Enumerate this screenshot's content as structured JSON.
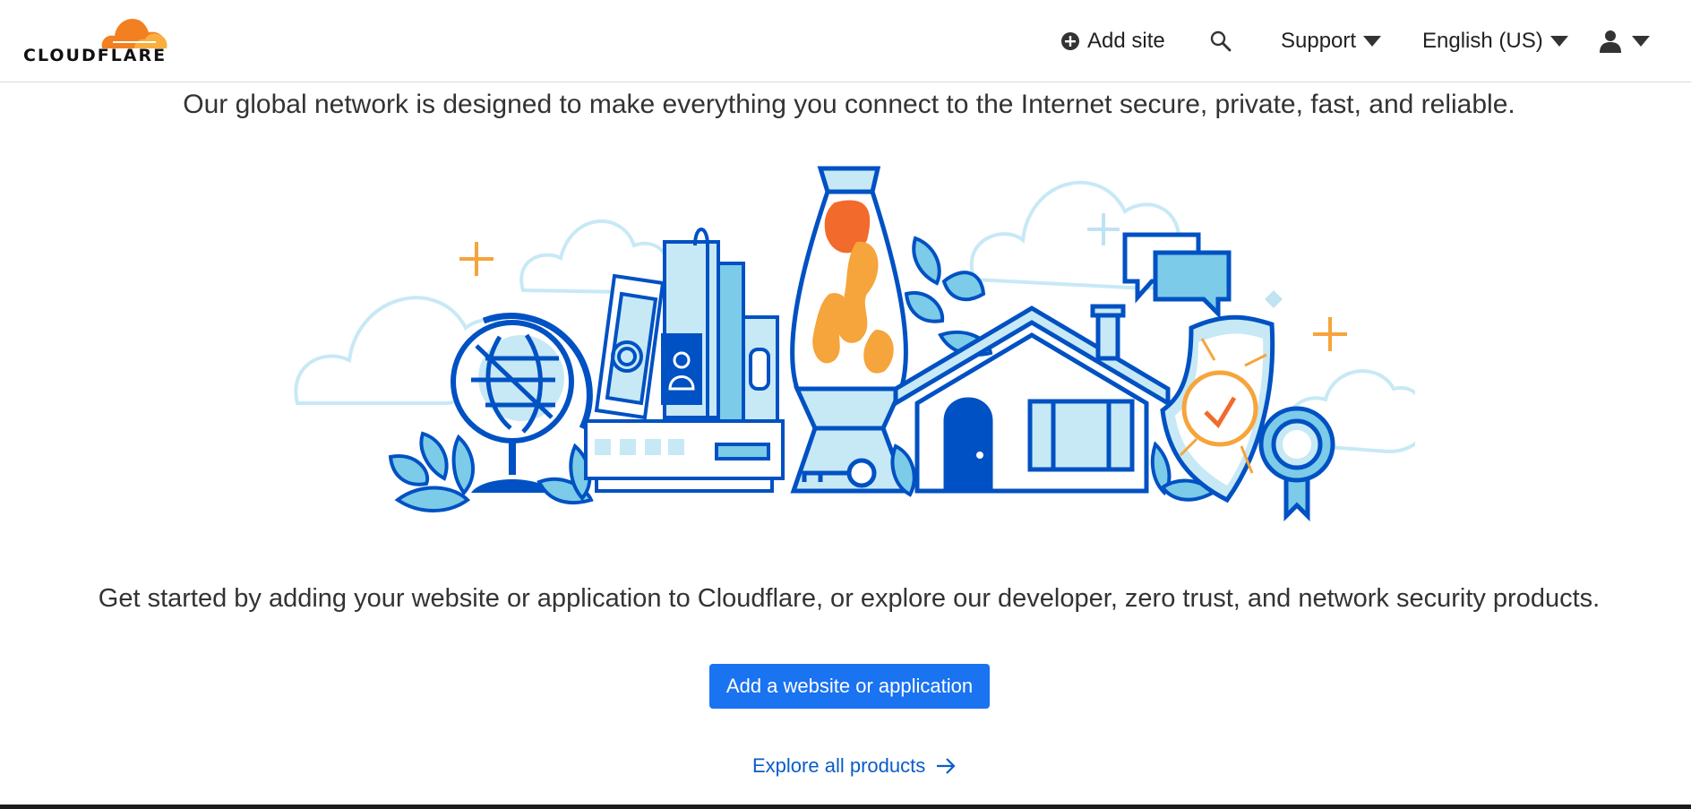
{
  "header": {
    "logo_text": "CLOUDFLARE",
    "add_site_label": "Add site",
    "support_label": "Support",
    "language_label": "English (US)"
  },
  "icons": {
    "logo": "cloudflare-cloud-icon",
    "add_site": "plus-circle-icon",
    "search": "search-icon",
    "user": "user-icon",
    "caret": "caret-down-icon",
    "explore": "arrow-right-icon"
  },
  "main": {
    "tagline": "Our global network is designed to make everything you connect to the Internet secure, private, fast, and reliable.",
    "intro": "Get started by adding your website or application to Cloudflare, or explore our developer, zero trust, and network security products.",
    "cta_label": "Add a website or application",
    "explore_label": "Explore all products"
  },
  "colors": {
    "brand_orange": "#f38020",
    "primary_blue": "#1a73f0",
    "link_blue": "#0b5cc9",
    "illustration_blue": "#0051c3",
    "illustration_light": "#c7e9f5"
  }
}
